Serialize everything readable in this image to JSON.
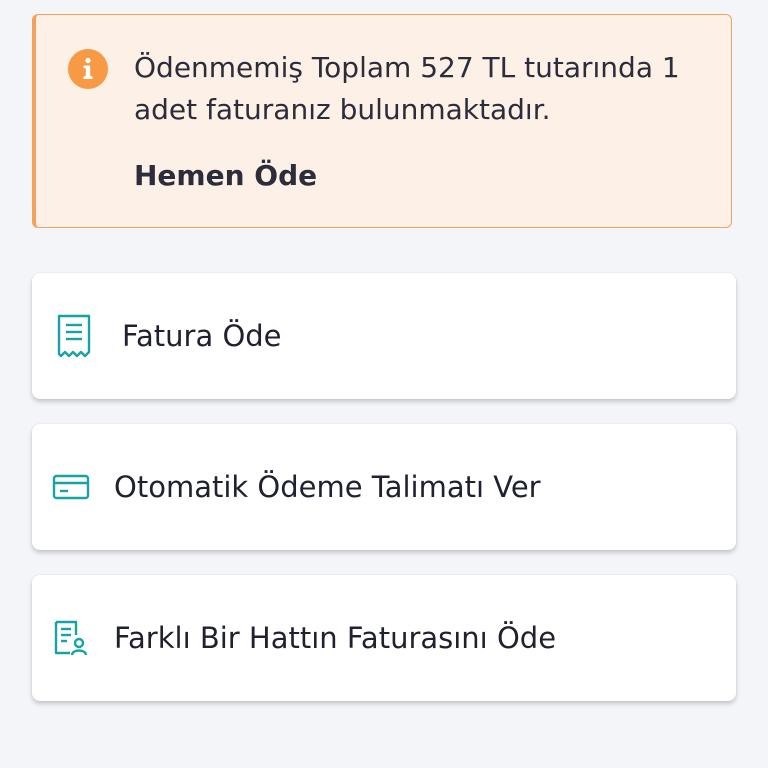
{
  "alert": {
    "icon": "info-icon",
    "message": "Ödenmemiş Toplam 527 TL tutarında 1 adet faturanız bulunmaktadır.",
    "action_label": "Hemen Öde",
    "accent_color": "#f79a45",
    "background_color": "#fdf0e6"
  },
  "menu": {
    "items": [
      {
        "label": "Fatura Öde",
        "icon": "receipt-icon"
      },
      {
        "label": "Otomatik Ödeme Talimatı Ver",
        "icon": "credit-card-icon"
      },
      {
        "label": "Farklı Bir Hattın Faturasını Öde",
        "icon": "document-user-icon"
      }
    ],
    "icon_color": "#17a2a6"
  }
}
